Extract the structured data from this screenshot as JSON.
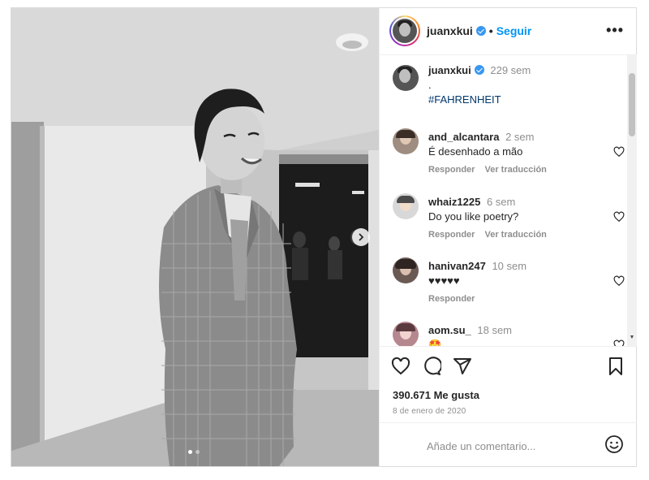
{
  "post": {
    "username": "juanxkui",
    "follow_label": "Seguir",
    "separator": "•",
    "more_label": "•••",
    "caption": {
      "time": "229 sem",
      "line1": ".",
      "hashtag": "#FAHRENHEIT"
    },
    "comments": [
      {
        "user": "and_alcantara",
        "time": "2 sem",
        "text": "É desenhado a mão",
        "reply": "Responder",
        "translate": "Ver traducción"
      },
      {
        "user": "whaiz1225",
        "time": "6 sem",
        "text": "Do you like poetry?",
        "reply": "Responder",
        "translate": "Ver traducción"
      },
      {
        "user": "hanivan247",
        "time": "10 sem",
        "text": "♥♥♥♥♥",
        "reply": "Responder"
      },
      {
        "user": "aom.su_",
        "time": "18 sem",
        "text": "🤩"
      }
    ],
    "likes": "390.671 Me gusta",
    "date": "8 de enero de 2020",
    "comment_placeholder": "Añade un comentario...",
    "carousel": {
      "total": 2,
      "active": 1
    }
  },
  "colors": {
    "accent": "#0095f6",
    "text": "#262626",
    "muted": "#8e8e8e",
    "border": "#dbdbdb"
  },
  "icons": [
    "verified-badge-icon",
    "more-options-icon",
    "heart-icon",
    "comment-icon",
    "share-icon",
    "bookmark-icon",
    "emoji-icon",
    "chevron-right-icon"
  ]
}
